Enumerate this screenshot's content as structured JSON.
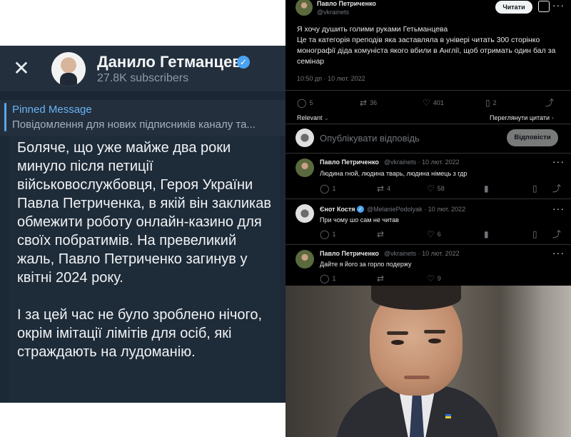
{
  "telegram": {
    "channel_title": "Данило Гетманцев",
    "subscribers": "27.8K subscribers",
    "pinned_label": "Pinned Message",
    "pinned_text": "Повідомлення для нових підписників каналу та...",
    "message_paragraphs": [
      "Боляче, що уже майже два роки минуло після петиції військовослужбовця, Героя України Павла Петриченка, в якій він закликав обмежити роботу онлайн-казино для своїх побратимів. На превеликий жаль, Павло Петриченко загинув у квітні 2024 року.",
      "І за цей час не було зроблено нічого, окрім імітації лімітів для осіб, які страждають на лудоманію."
    ]
  },
  "twitter": {
    "post": {
      "author": "Павло Петриченко",
      "handle": "@vkrainets",
      "follow_label": "Читати",
      "text": "Я хочу душить голими руками Гетьманцева\nЦе та категорія преподів яка заставляла в універі читать 300 сторінко монографії діда комуніста якого вбили в Англії, щоб отримать один бал за семінар",
      "timestamp": "10:50 дп · 10 лют. 2022",
      "stats": {
        "replies": "5",
        "reposts": "36",
        "likes": "401",
        "bookmarks": "2"
      }
    },
    "sort_label": "Relevant",
    "quotes_label": "Переглянути цитати",
    "compose_placeholder": "Опублікувати відповідь",
    "reply_button": "Відповісти",
    "replies": [
      {
        "author": "Павло Петриченко",
        "handle": "@vkrainets · 10 лют. 2022",
        "text": "Людина гной, людина тварь, людина німець з гдр",
        "stats": {
          "replies": "1",
          "reposts": "4",
          "likes": "58"
        }
      },
      {
        "author": "Єнот Костя",
        "handle": "@MelaniePodolyak · 10 лют. 2022",
        "text": "При чому шо сам не читав",
        "stats": {
          "replies": "1",
          "reposts": "",
          "likes": "6"
        }
      },
      {
        "author": "Павло Петриченко",
        "handle": "@vkrainets · 10 лют. 2022",
        "text": "Дайте я його за горло подержу",
        "stats": {
          "replies": "1",
          "reposts": "",
          "likes": "9"
        }
      }
    ]
  },
  "icons": {
    "close": "✕",
    "verified": "✓",
    "reply": "◯",
    "repost": "⇄",
    "like": "♡",
    "bookmark": "▯",
    "share": "⤴",
    "views": "▮",
    "more": "···"
  },
  "colors": {
    "telegram_bg": "#1c2735",
    "telegram_link": "#6ab3f3",
    "x_bg": "#000000",
    "x_text": "#e7e9ea",
    "x_muted": "#71767b"
  }
}
